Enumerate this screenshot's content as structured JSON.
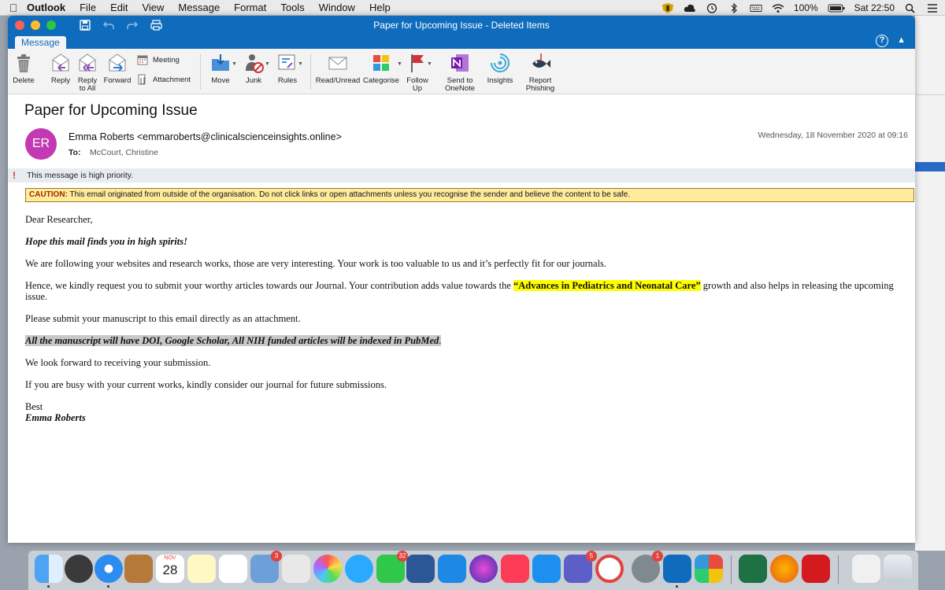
{
  "menubar": {
    "app": "Outlook",
    "items": [
      "File",
      "Edit",
      "View",
      "Message",
      "Format",
      "Tools",
      "Window",
      "Help"
    ],
    "battery": "100%",
    "clock": "Sat 22:50"
  },
  "window": {
    "title": "Paper for Upcoming Issue - Deleted Items",
    "tab": "Message"
  },
  "ribbon": {
    "delete": "Delete",
    "reply": "Reply",
    "reply_all_1": "Reply",
    "reply_all_2": "to All",
    "forward": "Forward",
    "meeting": "Meeting",
    "attachment": "Attachment",
    "move": "Move",
    "junk": "Junk",
    "rules": "Rules",
    "read_unread": "Read/Unread",
    "categorise": "Categorise",
    "follow_up_1": "Follow",
    "follow_up_2": "Up",
    "onenote_1": "Send to",
    "onenote_2": "OneNote",
    "insights": "Insights",
    "report_1": "Report",
    "report_2": "Phishing"
  },
  "email": {
    "subject": "Paper for Upcoming Issue",
    "avatar_initials": "ER",
    "avatar_color": "#c239b3",
    "from": "Emma Roberts <emmaroberts@clinicalscienceinsights.online>",
    "to_label": "To:",
    "to": "McCourt, Christine",
    "date": "Wednesday, 18 November 2020 at 09:16",
    "priority_notice": "This message is high priority.",
    "caution_label": "CAUTION:",
    "caution_text": " This email originated from outside of the organisation. Do not click links or open attachments unless you recognise the sender and believe the content to be safe.",
    "greeting": "Dear Researcher,",
    "line1": "Hope this mail finds you in high spirits!",
    "line2": "We are following your websites and research works, those are very interesting. Your work is too valuable to us and it’s perfectly fit for our journals.",
    "line3_a": "Hence, we kindly request you to submit your worthy articles towards our Journal. Your contribution adds value towards the ",
    "line3_highlight": "“Advances in Pediatrics and Neonatal Care”",
    "line3_b": " growth and also helps in releasing the upcoming issue.",
    "line4": "Please submit your manuscript to this email directly as an attachment.",
    "line5": "All the manuscript will have DOI, Google Scholar, All NIH funded articles will be indexed in PubMed",
    "line5_end": ".",
    "line6": "We look forward to receiving your submission.",
    "line7": "If you are busy with your current works, kindly consider our journal for future submissions.",
    "signoff": "Best",
    "signature": "Emma Roberts"
  },
  "dock": {
    "calendar_month": "NOV",
    "calendar_day": "28",
    "badges": {
      "mail": "3",
      "facetime": "32",
      "teams": "5",
      "settings": "1"
    }
  },
  "colors": {
    "outlook_blue": "#0f6cbd",
    "caution_bg": "#ffeb9c",
    "highlight_yellow": "#ffff00",
    "priority_red": "#d13438"
  }
}
